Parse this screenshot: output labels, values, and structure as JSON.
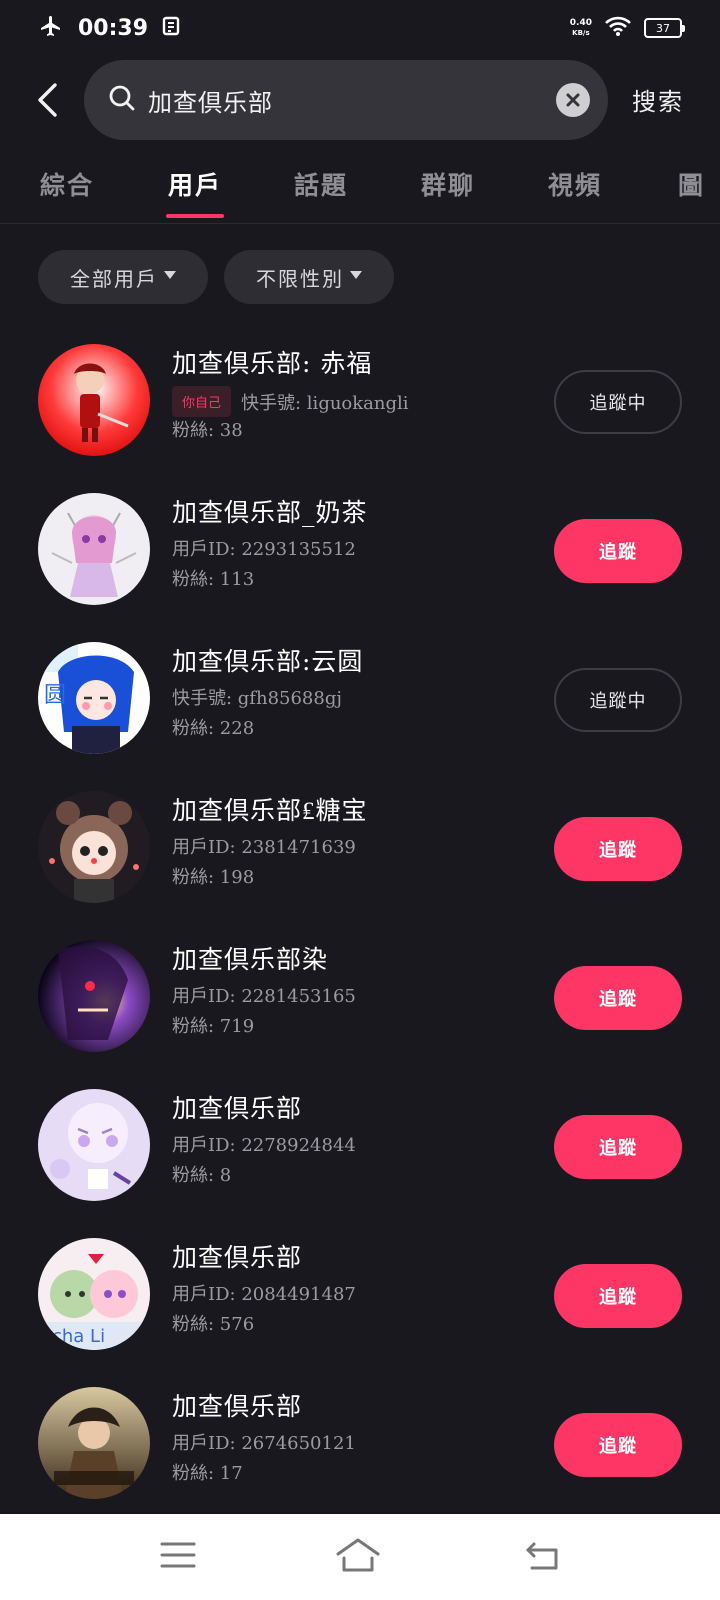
{
  "status_bar": {
    "time": "00:39",
    "net_speed_value": "0.40",
    "net_speed_unit": "KB/s",
    "battery": "37"
  },
  "search": {
    "query": "加查倶乐部",
    "submit_label": "搜索"
  },
  "tabs": [
    {
      "label": "綜合",
      "active": false
    },
    {
      "label": "用戶",
      "active": true
    },
    {
      "label": "話題",
      "active": false
    },
    {
      "label": "群聊",
      "active": false
    },
    {
      "label": "視頻",
      "active": false
    },
    {
      "label": "圖",
      "active": false
    }
  ],
  "filters": [
    {
      "label": "全部用戶"
    },
    {
      "label": "不限性別"
    }
  ],
  "users": [
    {
      "name": "加查倶乐部: 赤福",
      "self_tag": "你自己",
      "id_text": "快手號: liguokangli",
      "fans_text": "粉絲: 38",
      "button": "追蹤中",
      "following": true
    },
    {
      "name": "加查倶乐部_奶茶",
      "id_text": "用戶ID: 2293135512",
      "fans_text": "粉絲: 113",
      "button": "追蹤",
      "following": false
    },
    {
      "name": "加查倶乐部:云圆",
      "id_text": "快手號: gfh85688gj",
      "fans_text": "粉絲: 228",
      "button": "追蹤中",
      "following": true
    },
    {
      "name": "加查倶乐部₤糖宝",
      "id_text": "用戶ID: 2381471639",
      "fans_text": "粉絲: 198",
      "button": "追蹤",
      "following": false
    },
    {
      "name": "加查倶乐部染",
      "id_text": "用戶ID: 2281453165",
      "fans_text": "粉絲: 719",
      "button": "追蹤",
      "following": false
    },
    {
      "name": "加查倶乐部",
      "id_text": "用戶ID: 2278924844",
      "fans_text": "粉絲: 8",
      "button": "追蹤",
      "following": false
    },
    {
      "name": "加查倶乐部",
      "id_text": "用戶ID: 2084491487",
      "fans_text": "粉絲: 576",
      "button": "追蹤",
      "following": false
    },
    {
      "name": "加查倶乐部",
      "id_text": "用戶ID: 2674650121",
      "fans_text": "粉絲: 17",
      "button": "追蹤",
      "following": false
    }
  ],
  "colors": {
    "background": "#19181f",
    "accent": "#fe3666",
    "search_bg": "#35343b",
    "muted_text": "#9c9ba1"
  },
  "icons": {
    "status": [
      "airplane-mode-icon",
      "sim-status-icon",
      "wifi-icon",
      "battery-icon"
    ],
    "header": [
      "back-arrow-icon",
      "search-icon",
      "clear-icon"
    ],
    "nav": [
      "menu-icon",
      "home-icon",
      "back-icon"
    ]
  }
}
